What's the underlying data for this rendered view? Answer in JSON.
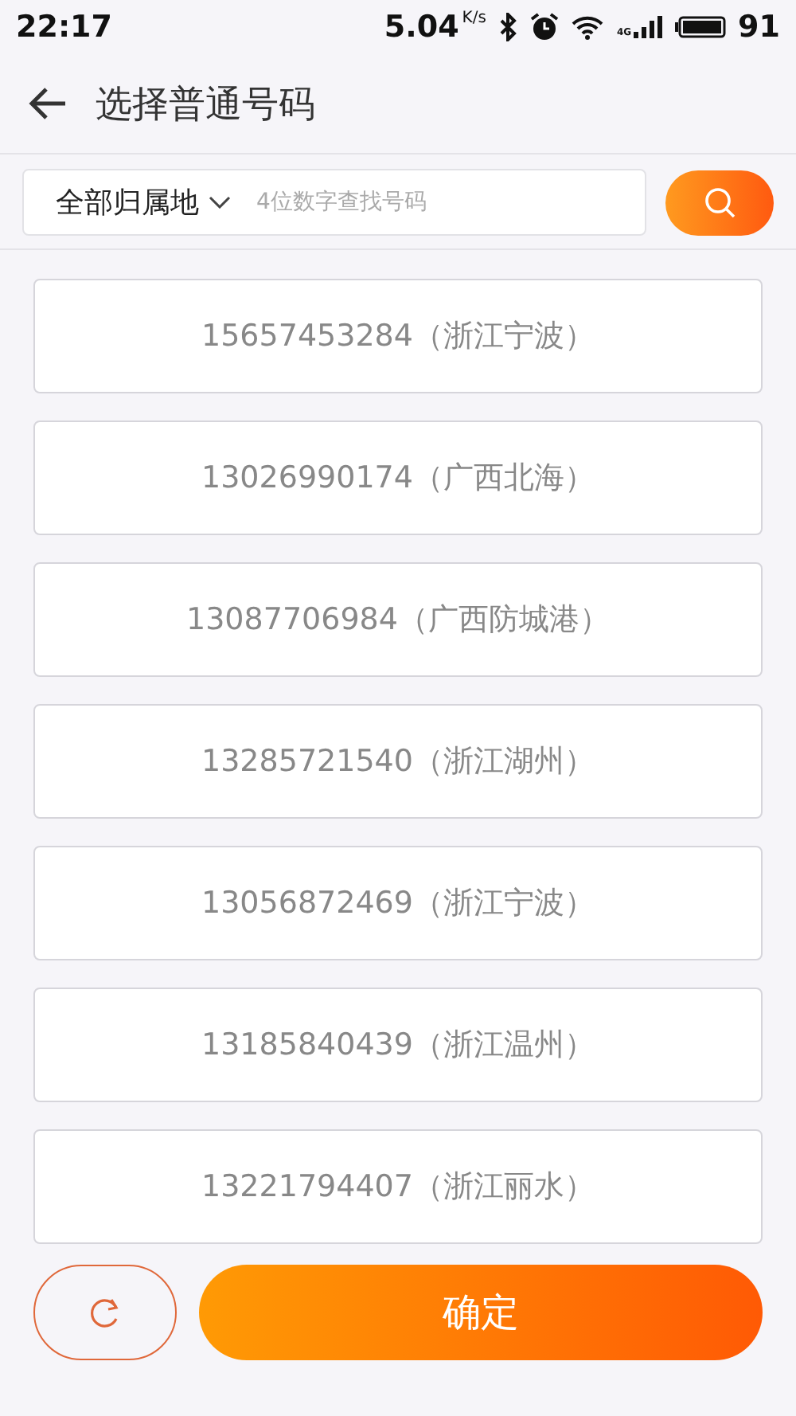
{
  "status_bar": {
    "time": "22:17",
    "speed": "5.04",
    "speed_unit": "K/s",
    "network": "4G",
    "battery": "91"
  },
  "header": {
    "title": "选择普通号码"
  },
  "search": {
    "region": "全部归属地",
    "placeholder": "4位数字查找号码"
  },
  "numbers": [
    {
      "label": "15657453284（浙江宁波）"
    },
    {
      "label": "13026990174（广西北海）"
    },
    {
      "label": "13087706984（广西防城港）"
    },
    {
      "label": "13285721540（浙江湖州）"
    },
    {
      "label": "13056872469（浙江宁波）"
    },
    {
      "label": "13185840439（浙江温州）"
    },
    {
      "label": "13221794407（浙江丽水）"
    }
  ],
  "confirm_button": "确定"
}
